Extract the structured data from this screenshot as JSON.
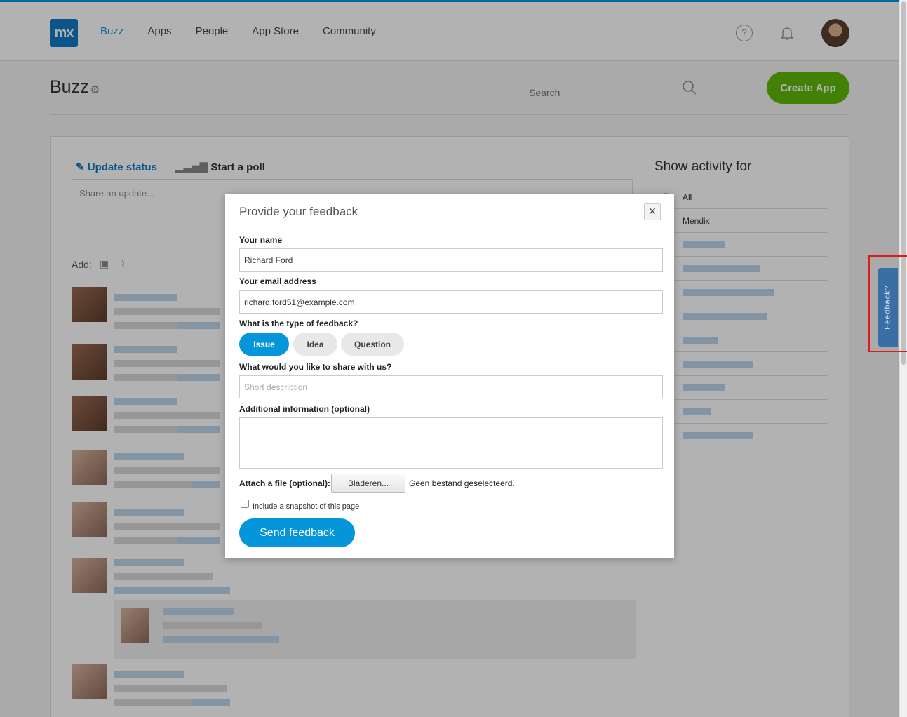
{
  "header": {
    "logo_text": "mx",
    "nav": [
      "Buzz",
      "Apps",
      "People",
      "App Store",
      "Community"
    ],
    "help_glyph": "?"
  },
  "page": {
    "title": "Buzz",
    "search_placeholder": "Search",
    "create_app_label": "Create App"
  },
  "composer": {
    "update_status_label": "Update status",
    "start_poll_label": "Start a poll",
    "share_placeholder": "Share an update...",
    "add_label": "Add:"
  },
  "sidebar": {
    "title": "Show activity for",
    "items": [
      "All",
      "Mendix"
    ]
  },
  "feedback_tab": {
    "label": "Feedback?"
  },
  "modal": {
    "title": "Provide your feedback",
    "close_glyph": "×",
    "name_label": "Your name",
    "name_value": "Richard Ford",
    "email_label": "Your email address",
    "email_value": "richard.ford51@example.com",
    "type_label": "What is the type of feedback?",
    "types": [
      "Issue",
      "Idea",
      "Question"
    ],
    "selected_type": "Issue",
    "share_label": "What would you like to share with us?",
    "share_placeholder": "Short description",
    "additional_label": "Additional information (optional)",
    "attach_label": "Attach a file (optional):",
    "browse_label": "Bladeren...",
    "file_status": "Geen bestand geselecteerd.",
    "snapshot_label": "Include a snapshot of this page",
    "send_label": "Send feedback"
  },
  "colors": {
    "accent": "#0595db",
    "create_button": "#5fb90a",
    "logo": "#0f7ac4",
    "highlight": "#e0191a",
    "feedback_tab": "#3a6fa5"
  },
  "icons": [
    "gear-icon",
    "search-icon",
    "help-icon",
    "bell-icon",
    "pencil-icon",
    "poll-icon",
    "image-icon",
    "paperclip-icon",
    "close-icon"
  ]
}
